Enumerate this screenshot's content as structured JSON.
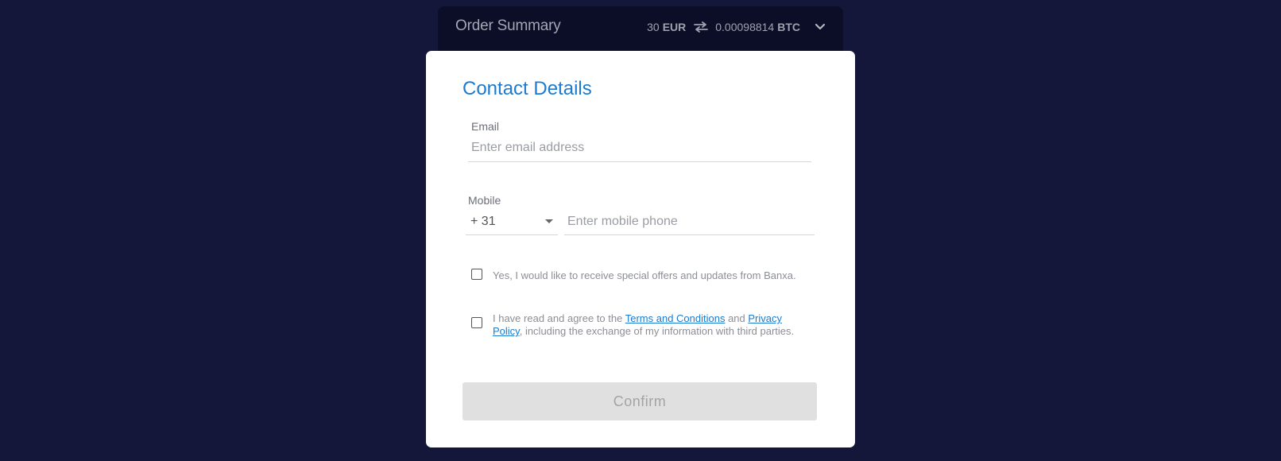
{
  "order_summary": {
    "title": "Order Summary",
    "fiat_amount": "30",
    "fiat_currency": "EUR",
    "crypto_amount": "0.00098814",
    "crypto_currency": "BTC",
    "swap_icon": "swap-arrows-icon",
    "expand_icon": "chevron-down-icon"
  },
  "contact_form": {
    "title": "Contact Details",
    "email": {
      "label": "Email",
      "value": "",
      "placeholder": "Enter email address"
    },
    "mobile": {
      "label": "Mobile",
      "country_code": "+ 31",
      "value": "",
      "placeholder": "Enter mobile phone"
    },
    "offers_checkbox": {
      "checked": false,
      "label": "Yes, I would like to receive special offers and updates from Banxa."
    },
    "terms_checkbox": {
      "checked": false,
      "text_before": "I have read and agree to the ",
      "terms_link": "Terms and Conditions",
      "text_middle": " and ",
      "privacy_link": "Privacy Policy",
      "text_after": ", including the exchange of my information with third parties."
    },
    "confirm_label": "Confirm"
  },
  "colors": {
    "page_background": "#14163a",
    "summary_background": "#0c0e28",
    "accent": "#1a7bd0",
    "button_disabled": "#e0e0e0"
  }
}
